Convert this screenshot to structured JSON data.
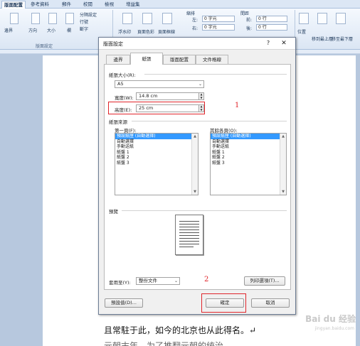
{
  "ribbon": {
    "tabs": [
      "版面配置",
      "參考資料",
      "郵件",
      "校閱",
      "檢視",
      "增益集"
    ],
    "active_tab_index": 0,
    "buttons": [
      "邊界",
      "方向",
      "大小",
      "欄"
    ],
    "line_numbers": "行號",
    "breaks": "分隔設定",
    "hyphenation": "斷字",
    "watermark": "浮水印",
    "page_color": "頁面色彩",
    "page_borders": "頁面框線",
    "indent_label": "縮排",
    "indent_left_label": "左:",
    "indent_left_value": "0 字元",
    "indent_right_label": "右:",
    "indent_right_value": "0 字元",
    "spacing_label": "間距",
    "spacing_before_label": "前:",
    "spacing_before_value": "0 行",
    "spacing_after_label": "後:",
    "spacing_after_value": "0 行",
    "position": "位置",
    "bring_forward": "移到最上層",
    "send_backward": "移至最下層",
    "group_page_setup": "版面設定"
  },
  "document": {
    "line1": "且常駐于此，如今的北京也从此得名。↵",
    "line2": "元朝末年，为了推翻元朝的统治……"
  },
  "watermark": {
    "brand": "Bai du 经验",
    "url": "jingyan.baidu.com"
  },
  "dialog": {
    "title": "版面設定",
    "help": "?",
    "close": "✕",
    "tabs": [
      "邊界",
      "紙張",
      "版面配置",
      "文件格線"
    ],
    "active_tab_index": 1,
    "paper_size_group": "紙張大小(R):",
    "paper_size_value": "A5",
    "width_label": "寬度(W):",
    "width_value": "14.8 cm",
    "height_label": "高度(E):",
    "height_value": "25 cm",
    "paper_source_group": "紙張來源",
    "first_page_label": "第一頁(F):",
    "first_page_items": [
      "預設紙匣 (自動選擇)",
      "自動選擇",
      "手動送紙",
      "紙盤 1",
      "紙盤 2",
      "紙盤 3"
    ],
    "other_pages_label": "其餘各頁(O):",
    "other_pages_items": [
      "預設紙匣 (自動選擇)",
      "自動選擇",
      "手動送紙",
      "紙盤 1",
      "紙盤 2",
      "紙盤 3"
    ],
    "preview_group": "預覽",
    "apply_to_label": "套用至(Y):",
    "apply_to_value": "整份文件",
    "print_options": "列印選項(T)...",
    "default_button": "預設值(D)...",
    "ok_button": "確定",
    "cancel_button": "取消"
  },
  "annotations": {
    "marker_1": "1",
    "marker_2": "2",
    "color": "#e0252b"
  }
}
